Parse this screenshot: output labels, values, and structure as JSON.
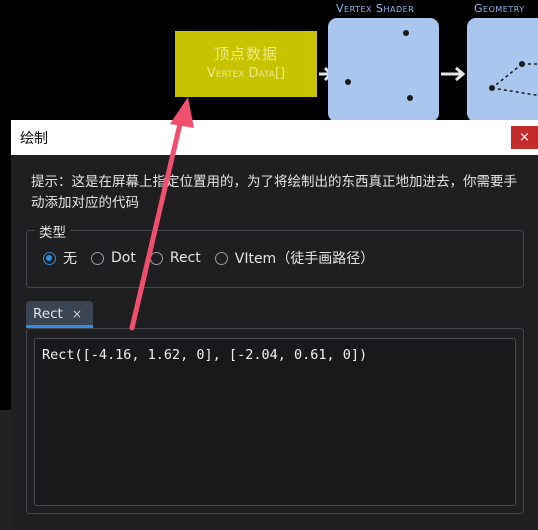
{
  "background": {
    "vertex_data": {
      "chinese_label": "顶点数据",
      "english_label": "Vertex Data[]"
    },
    "stages": [
      {
        "label": "Vertex Shader"
      },
      {
        "label": "Geometry"
      }
    ]
  },
  "dialog": {
    "title": "绘制",
    "close_glyph": "×",
    "tip": "提示：这是在屏幕上指定位置用的，为了将绘制出的东西真正地加进去，你需要手动添加对应的代码",
    "type_group": {
      "title": "类型",
      "options": [
        {
          "label": "无",
          "checked": true
        },
        {
          "label": "Dot",
          "checked": false
        },
        {
          "label": "Rect",
          "checked": false
        },
        {
          "label": "VItem（徒手画路径）",
          "checked": false
        }
      ]
    },
    "tab": {
      "label": "Rect",
      "close_glyph": "×"
    },
    "editor_text": "Rect([-4.16, 1.62, 0], [-2.04, 0.61, 0])"
  },
  "colors": {
    "accent": "#2f8ee3",
    "annotation_arrow": "#f0506e",
    "vertex_data_fill": "#c8c300",
    "stage_fill": "#a9c6ee"
  }
}
